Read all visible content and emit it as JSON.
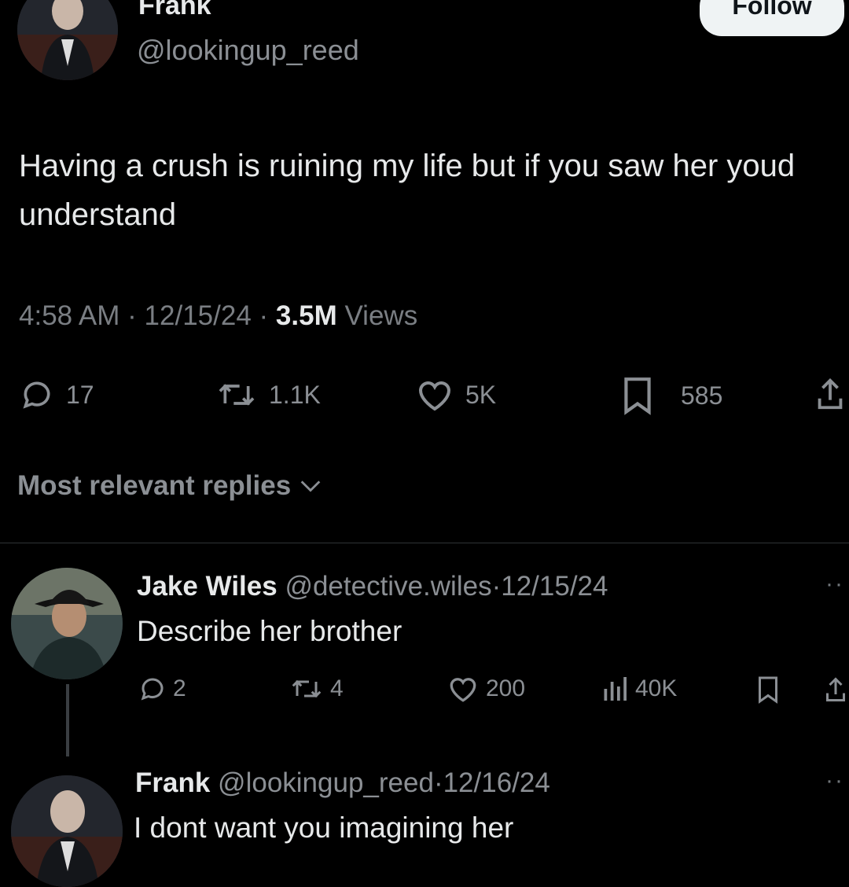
{
  "post": {
    "author_name": "Frank",
    "author_handle": "@lookingup_reed",
    "follow_label": "Follow",
    "text": "Having a crush is ruining my life but if you saw her youd understand",
    "time": "4:58 AM",
    "date": "12/15/24",
    "views_count": "3.5M",
    "views_label": "Views",
    "separator": "·",
    "actions": {
      "replies": "17",
      "reposts": "1.1K",
      "likes": "5K",
      "bookmarks": "585"
    }
  },
  "sort_label": "Most relevant replies",
  "replies": [
    {
      "name": "Jake Wiles",
      "handle": "@detective.wiles",
      "date": "12/15/24",
      "text": "Describe her brother",
      "actions": {
        "replies": "2",
        "reposts": "4",
        "likes": "200",
        "views": "40K"
      }
    },
    {
      "name": "Frank",
      "handle": "@lookingup_reed",
      "date": "12/16/24",
      "text": "I dont want you imagining her"
    }
  ],
  "icons": {
    "reply": "reply-icon",
    "repost": "repost-icon",
    "like": "heart-icon",
    "bookmark": "bookmark-icon",
    "share": "share-icon",
    "views": "views-icon",
    "more": "more-icon",
    "chevron": "chevron-down-icon"
  },
  "colors": {
    "background": "#000000",
    "text_primary": "#e7e9ea",
    "text_secondary": "#8b8f94",
    "follow_bg": "#eff3f4",
    "follow_text": "#0f1419"
  }
}
